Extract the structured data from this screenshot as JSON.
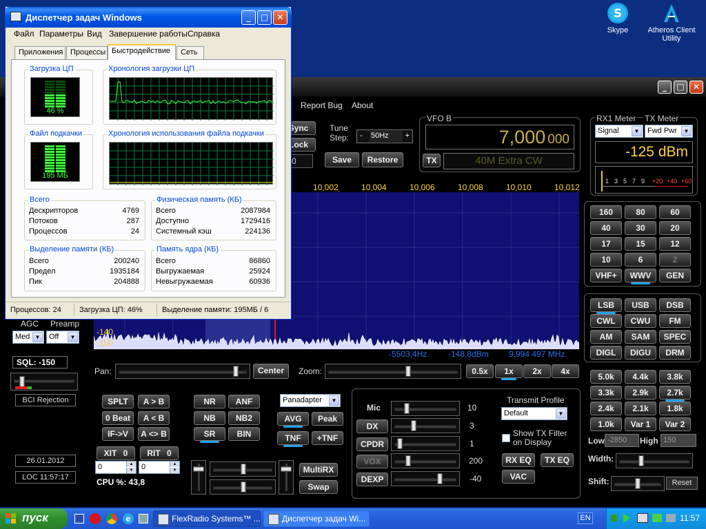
{
  "desktop": {
    "icons": [
      {
        "label": "Skype",
        "icon": "skype-icon"
      },
      {
        "label": "Atheros Client Utility",
        "icon": "atheros-icon"
      }
    ]
  },
  "flexradio": {
    "menu": [
      "Report Bug",
      "About"
    ],
    "vfo_b": {
      "label": "VFO B",
      "frequency_main": "7,000",
      "frequency_sub": "000",
      "band_text": "40M Extra CW",
      "tx_label": "TX"
    },
    "tune": {
      "label": "Tune Step:",
      "minus": "-",
      "value": "50Hz",
      "plus": "+",
      "sync_label": "Sync",
      "lock_label": "Lock",
      "partial_value": "0",
      "save_label": "Save",
      "restore_label": "Restore"
    },
    "meter": {
      "rx_label": "RX1 Meter",
      "tx_label": "TX Meter",
      "rx_select": "Signal",
      "tx_select": "Fwd Pwr",
      "reading": "-125 dBm",
      "scale": [
        "1",
        "3",
        "5",
        "7",
        "9",
        "+20",
        "+40",
        "+60"
      ]
    },
    "panadapter": {
      "freq_ticks": [
        "10,002",
        "10,004",
        "10,006",
        "10,008",
        "10,010",
        "10,012"
      ],
      "db_labels": [
        "-140",
        "-150"
      ],
      "cursor_offset": "-5503,4Hz",
      "cursor_dbm": "-148,8dBm",
      "cursor_freq": "9,994 497 MHz"
    },
    "agc": {
      "label": "AGC",
      "value": "Med"
    },
    "preamp": {
      "label": "Preamp",
      "value": "Off"
    },
    "sql": {
      "label": "SQL:",
      "value": "-150"
    },
    "bci_label": "BCI Rejection",
    "date": "26.01.2012",
    "loc_time": "LOC 11:57:17",
    "pan": {
      "label": "Pan:",
      "center_label": "Center"
    },
    "zoom": {
      "label": "Zoom:",
      "buttons": [
        "0.5x",
        "1x",
        "2x",
        "4x"
      ],
      "active": "1x"
    },
    "vfo_buttons": {
      "split": "SPLT",
      "a_to_b": "A > B",
      "zero_beat": "0 Beat",
      "b_to_a": "A < B",
      "if_to_v": "IF->V",
      "swap_ab": "A <> B"
    },
    "xit": {
      "label": "XIT",
      "value": "0",
      "input": "0"
    },
    "rit": {
      "label": "RIT",
      "value": "0",
      "input": "0"
    },
    "cpu": "CPU %: 43,8",
    "dsp_buttons": {
      "nr": "NR",
      "anf": "ANF",
      "nb": "NB",
      "nb2": "NB2",
      "sr": "SR",
      "bin": "BIN"
    },
    "display_mode": "Panadapter",
    "avg": "AVG",
    "peak": "Peak",
    "tnf": "TNF",
    "add_tnf": "+TNF",
    "multirx": "MultiRX",
    "swap": "Swap",
    "tx_controls": [
      {
        "label": "Mic",
        "value": "10"
      },
      {
        "label": "DX",
        "value": "3"
      },
      {
        "label": "CPDR",
        "value": "1"
      },
      {
        "label": "VOX",
        "value": "200"
      },
      {
        "label": "DEXP",
        "value": "-40"
      }
    ],
    "rx_eq": "RX EQ",
    "tx_eq": "TX EQ",
    "vac": "VAC",
    "transmit_profile": {
      "label": "Transmit Profile",
      "value": "Default"
    },
    "show_tx_filter": "Show TX Filter on Display",
    "bands": [
      "160",
      "80",
      "60",
      "40",
      "30",
      "20",
      "17",
      "15",
      "12",
      "10",
      "6",
      "2",
      "VHF+",
      "WWV",
      "GEN"
    ],
    "active_band": "WWV",
    "modes": [
      "LSB",
      "USB",
      "DSB",
      "CWL",
      "CWU",
      "FM",
      "AM",
      "SAM",
      "SPEC",
      "DIGL",
      "DIGU",
      "DRM"
    ],
    "active_mode": "LSB",
    "filters": [
      "5.0k",
      "4.4k",
      "3.8k",
      "3.3k",
      "2.9k",
      "2.7k",
      "2.4k",
      "2.1k",
      "1.8k",
      "1.0k",
      "Var 1",
      "Var 2"
    ],
    "active_filter": "2.7k",
    "low": {
      "label": "Low",
      "value": "-2850"
    },
    "high": {
      "label": "High",
      "value": "150"
    },
    "width_label": "Width:",
    "shift_label": "Shift:",
    "reset_label": "Reset"
  },
  "taskmanager": {
    "title": "Диспетчер задач Windows",
    "menu": [
      "Файл",
      "Параметры",
      "Вид",
      "Завершение работы",
      "Справка"
    ],
    "tabs": [
      "Приложения",
      "Процессы",
      "Быстродействие",
      "Сеть"
    ],
    "active_tab": "Быстродействие",
    "cpu_usage_title": "Загрузка ЦП",
    "cpu_usage_value": "46 %",
    "cpu_usage_fraction": 0.46,
    "cpu_history_title": "Хронология загрузки ЦП",
    "pagefile_title": "Файл подкачки",
    "pagefile_value": "195 МБ",
    "pagefile_history_title": "Хронология использования файла подкачки",
    "totals": {
      "title": "Всего",
      "rows": [
        [
          "Дескрипторов",
          "4769"
        ],
        [
          "Потоков",
          "287"
        ],
        [
          "Процессов",
          "24"
        ]
      ]
    },
    "physical": {
      "title": "Физическая память (КБ)",
      "rows": [
        [
          "Всего",
          "2087984"
        ],
        [
          "Доступно",
          "1729416"
        ],
        [
          "Системный кэш",
          "224136"
        ]
      ]
    },
    "commit": {
      "title": "Выделение памяти (КБ)",
      "rows": [
        [
          "Всего",
          "200240"
        ],
        [
          "Предел",
          "1935184"
        ],
        [
          "Пик",
          "204888"
        ]
      ]
    },
    "kernel": {
      "title": "Память ядра (КБ)",
      "rows": [
        [
          "Всего",
          "86860"
        ],
        [
          "Выгружаемая",
          "25924"
        ],
        [
          "Невыгружаемая",
          "60936"
        ]
      ]
    },
    "status": {
      "processes": "Процессов: 24",
      "cpu": "Загрузка ЦП: 46%",
      "memory": "Выделение памяти: 195МБ / 6"
    }
  },
  "taskbar": {
    "start_label": "пуск",
    "tasks": [
      {
        "label": "FlexRadio Systems™ ...",
        "icon": "flexradio-icon"
      },
      {
        "label": "Диспетчер задач Wi...",
        "icon": "taskmanager-icon"
      }
    ],
    "language": "EN",
    "clock": "11:57"
  },
  "colors": {
    "desktop": "#0b2e80",
    "vfo_text": "#c9b24a",
    "meter_text": "#ffd23c",
    "active_indicator": "#1fa3e8",
    "xp_title": "#0058e6",
    "spectrum_bg": "#101072"
  }
}
